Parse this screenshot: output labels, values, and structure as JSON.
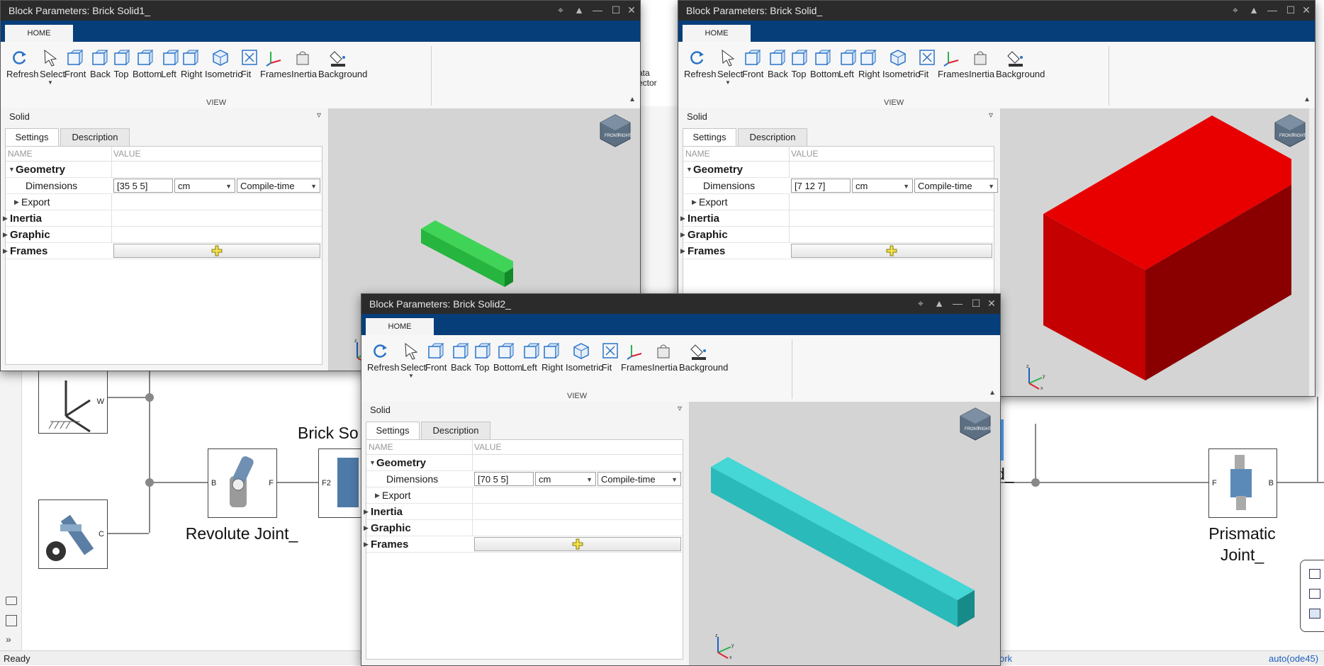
{
  "canvas": {
    "status_left": "Ready",
    "status_right": "auto(ode45)",
    "status_mid": "ork",
    "block_captions": {
      "revolute": "Revolute Joint_",
      "prismatic_line1": "Prismatic",
      "prismatic_line2": "Joint_",
      "brick": "Brick So",
      "brick_right": "d_"
    },
    "ports": {
      "w": "W",
      "c": "C",
      "b": "B",
      "f": "F",
      "f2": "F2"
    },
    "behind_partial": {
      "line1": "ata",
      "line2": "ector"
    }
  },
  "windows": [
    {
      "title": "Block Parameters: Brick Solid1_",
      "tab": "HOME",
      "section": "VIEW",
      "toolbar": [
        "Refresh",
        "Select",
        "Front",
        "Back",
        "Top",
        "Bottom",
        "Left",
        "Right",
        "Isometric",
        "Fit",
        "Frames",
        "Inertia",
        "Background"
      ],
      "panel_title": "Solid",
      "subtabs": [
        "Settings",
        "Description"
      ],
      "grid_headers": [
        "NAME",
        "VALUE"
      ],
      "rows": {
        "geometry": "Geometry",
        "dimensions": "Dimensions",
        "export": "Export",
        "inertia": "Inertia",
        "graphic": "Graphic",
        "frames": "Frames"
      },
      "dim_value": "[35 5 5]",
      "unit": "cm",
      "compile": "Compile-time",
      "cube_labels": {
        "front": "FRONT",
        "right": "RIGHT"
      },
      "solid_color": "#25c03e"
    },
    {
      "title": "Block Parameters: Brick Solid_",
      "tab": "HOME",
      "section": "VIEW",
      "toolbar": [
        "Refresh",
        "Select",
        "Front",
        "Back",
        "Top",
        "Bottom",
        "Left",
        "Right",
        "Isometric",
        "Fit",
        "Frames",
        "Inertia",
        "Background"
      ],
      "panel_title": "Solid",
      "subtabs": [
        "Settings",
        "Description"
      ],
      "grid_headers": [
        "NAME",
        "VALUE"
      ],
      "rows": {
        "geometry": "Geometry",
        "dimensions": "Dimensions",
        "export": "Export",
        "inertia": "Inertia",
        "graphic": "Graphic",
        "frames": "Frames"
      },
      "dim_value": "[7 12 7]",
      "unit": "cm",
      "compile": "Compile-time",
      "cube_labels": {
        "front": "FRONT",
        "right": "RIGHT"
      },
      "solid_color": "#d40000"
    },
    {
      "title": "Block Parameters: Brick Solid2_",
      "tab": "HOME",
      "section": "VIEW",
      "toolbar": [
        "Refresh",
        "Select",
        "Front",
        "Back",
        "Top",
        "Bottom",
        "Left",
        "Right",
        "Isometric",
        "Fit",
        "Frames",
        "Inertia",
        "Background"
      ],
      "panel_title": "Solid",
      "subtabs": [
        "Settings",
        "Description"
      ],
      "grid_headers": [
        "NAME",
        "VALUE"
      ],
      "rows": {
        "geometry": "Geometry",
        "dimensions": "Dimensions",
        "export": "Export",
        "inertia": "Inertia",
        "graphic": "Graphic",
        "frames": "Frames"
      },
      "dim_value": "[70 5 5]",
      "unit": "cm",
      "compile": "Compile-time",
      "cube_labels": {
        "front": "FRONT",
        "right": "RIGHT"
      },
      "solid_color": "#2ec4c4"
    }
  ],
  "axes": {
    "x": "x",
    "y": "y",
    "z": "z"
  },
  "window_controls": {
    "pin": "pin-icon",
    "up": "collapse-icon",
    "min": "minimize-icon",
    "max": "maximize-icon",
    "close": "close-icon"
  }
}
